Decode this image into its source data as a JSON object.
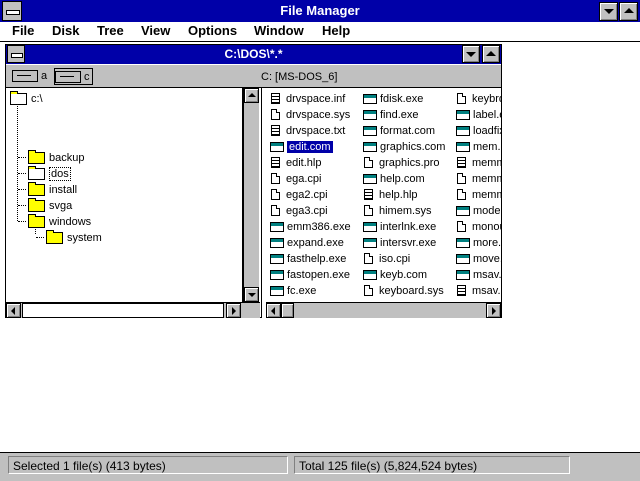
{
  "window": {
    "title": "File Manager"
  },
  "menu": {
    "items": [
      "File",
      "Disk",
      "Tree",
      "View",
      "Options",
      "Window",
      "Help"
    ]
  },
  "child_window": {
    "title": "C:\\DOS\\*.*",
    "drives": [
      {
        "letter": "a",
        "icon": "floppy-drive-icon"
      },
      {
        "letter": "c",
        "icon": "hard-drive-icon"
      }
    ],
    "volume_label": "C: [MS-DOS_6]"
  },
  "tree": {
    "items": [
      {
        "label": "c:\\",
        "icon": "open-folder-icon"
      },
      {
        "label": "backup",
        "icon": "folder-icon"
      },
      {
        "label": "dos",
        "icon": "open-folder-icon"
      },
      {
        "label": "install",
        "icon": "folder-icon"
      },
      {
        "label": "svga",
        "icon": "folder-icon"
      },
      {
        "label": "windows",
        "icon": "folder-icon"
      },
      {
        "label": "system",
        "icon": "folder-icon"
      }
    ]
  },
  "files": {
    "columns": [
      [
        {
          "name": "drvspace.inf",
          "icon": "text-file-icon"
        },
        {
          "name": "drvspace.sys",
          "icon": "document-icon"
        },
        {
          "name": "drvspace.txt",
          "icon": "text-file-icon"
        },
        {
          "name": "edit.com",
          "icon": "program-icon"
        },
        {
          "name": "edit.hlp",
          "icon": "text-file-icon"
        },
        {
          "name": "ega.cpi",
          "icon": "document-icon"
        },
        {
          "name": "ega2.cpi",
          "icon": "document-icon"
        },
        {
          "name": "ega3.cpi",
          "icon": "document-icon"
        },
        {
          "name": "emm386.exe",
          "icon": "program-icon"
        },
        {
          "name": "expand.exe",
          "icon": "program-icon"
        },
        {
          "name": "fasthelp.exe",
          "icon": "program-icon"
        },
        {
          "name": "fastopen.exe",
          "icon": "program-icon"
        },
        {
          "name": "fc.exe",
          "icon": "program-icon"
        }
      ],
      [
        {
          "name": "fdisk.exe",
          "icon": "program-icon"
        },
        {
          "name": "find.exe",
          "icon": "program-icon"
        },
        {
          "name": "format.com",
          "icon": "program-icon"
        },
        {
          "name": "graphics.com",
          "icon": "program-icon"
        },
        {
          "name": "graphics.pro",
          "icon": "document-icon"
        },
        {
          "name": "help.com",
          "icon": "program-icon"
        },
        {
          "name": "help.hlp",
          "icon": "text-file-icon"
        },
        {
          "name": "himem.sys",
          "icon": "document-icon"
        },
        {
          "name": "interlnk.exe",
          "icon": "program-icon"
        },
        {
          "name": "intersvr.exe",
          "icon": "program-icon"
        },
        {
          "name": "iso.cpi",
          "icon": "document-icon"
        },
        {
          "name": "keyb.com",
          "icon": "program-icon"
        },
        {
          "name": "keyboard.sys",
          "icon": "document-icon"
        }
      ],
      [
        {
          "name": "keybrd",
          "icon": "document-icon"
        },
        {
          "name": "label.e",
          "icon": "program-icon"
        },
        {
          "name": "loadfix.",
          "icon": "program-icon"
        },
        {
          "name": "mem.e",
          "icon": "program-icon"
        },
        {
          "name": "memm",
          "icon": "text-file-icon"
        },
        {
          "name": "memm",
          "icon": "document-icon"
        },
        {
          "name": "memm",
          "icon": "document-icon"
        },
        {
          "name": "mode.c",
          "icon": "program-icon"
        },
        {
          "name": "monou",
          "icon": "document-icon"
        },
        {
          "name": "more.c",
          "icon": "program-icon"
        },
        {
          "name": "move.e",
          "icon": "program-icon"
        },
        {
          "name": "msav.e",
          "icon": "program-icon"
        },
        {
          "name": "msav.h",
          "icon": "text-file-icon"
        }
      ]
    ],
    "selected": "edit.com"
  },
  "status": {
    "selected": "Selected 1 file(s) (413 bytes)",
    "total": "Total 125 file(s) (5,824,524 bytes)"
  },
  "colors": {
    "title_bar": "#0000a8",
    "chrome": "#c0c0c0",
    "folder": "#ffff00",
    "program_icon_band": "#008080"
  }
}
